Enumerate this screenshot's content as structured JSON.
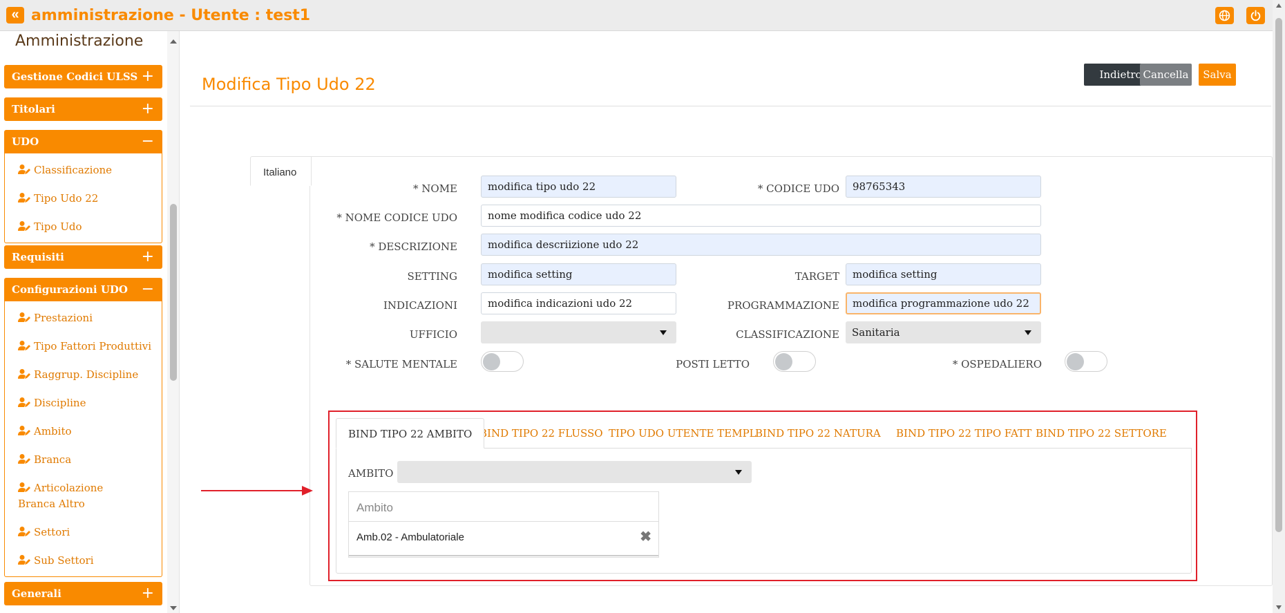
{
  "header": {
    "collapse_glyph": "«",
    "title": "amministrazione - Utente : test1",
    "icons": [
      "globe-icon",
      "power-icon"
    ]
  },
  "sidebar": {
    "heading": "Amministrazione",
    "sections": [
      {
        "label": "Gestione Codici ULSS",
        "sign": "+"
      },
      {
        "label": "Titolari",
        "sign": "+"
      },
      {
        "label": "UDO",
        "sign": "−",
        "items": [
          "Classificazione",
          "Tipo Udo 22",
          "Tipo Udo"
        ]
      },
      {
        "label": "Requisiti",
        "sign": "+"
      },
      {
        "label": "Configurazioni UDO",
        "sign": "−",
        "items": [
          "Prestazioni",
          "Tipo Fattori Produttivi",
          "Raggrup. Discipline",
          "Discipline",
          "Ambito",
          "Branca",
          "Articolazione Branca Altro",
          "Settori",
          "Sub Settori"
        ]
      },
      {
        "label": "Generali",
        "sign": "+"
      }
    ]
  },
  "page": {
    "title": "Modifica Tipo Udo 22",
    "buttons": {
      "back": "Indietro",
      "cancel": "Cancella",
      "save": "Salva"
    },
    "lang_tab": "Italiano"
  },
  "form": {
    "nome": {
      "label": "* NOME",
      "value": "modifica tipo udo 22"
    },
    "codice_udo": {
      "label": "* CODICE UDO",
      "value": "98765343"
    },
    "nome_codice_udo": {
      "label": "* NOME CODICE UDO",
      "value": "nome modifica codice udo 22"
    },
    "descrizione": {
      "label": "* DESCRIZIONE",
      "value": "modifica descriizione udo 22"
    },
    "setting": {
      "label": "SETTING",
      "value": "modifica setting"
    },
    "target": {
      "label": "TARGET",
      "value": "modifica setting"
    },
    "indicazioni": {
      "label": "INDICAZIONI",
      "value": "modifica indicazioni udo 22"
    },
    "programmazione": {
      "label": "PROGRAMMAZIONE",
      "value": "modifica programmazione udo 22"
    },
    "ufficio": {
      "label": "UFFICIO",
      "value": ""
    },
    "classificazione": {
      "label": "CLASSIFICAZIONE",
      "value": "Sanitaria"
    },
    "salute_mentale": {
      "label": "* SALUTE MENTALE",
      "on": false
    },
    "posti_letto": {
      "label": "POSTI LETTO",
      "on": false
    },
    "ospedaliero": {
      "label": "* OSPEDALIERO",
      "on": false
    }
  },
  "bind": {
    "tabs": [
      "BIND TIPO 22 AMBITO",
      "BIND TIPO 22 FLUSSO",
      "TIPO UDO UTENTE TEMPL",
      "BIND TIPO 22 NATURA",
      "BIND TIPO 22 TIPO FATT",
      "BIND TIPO 22 SETTORE"
    ],
    "active_tab": 0,
    "ambito_label": "AMBITO",
    "ambito_selected": "",
    "table_header": "Ambito",
    "rows": [
      "Amb.02 - Ambulatoriale"
    ],
    "delete_glyph": "✖"
  },
  "colors": {
    "accent": "#f98a00",
    "highlight": "#e0202a"
  }
}
